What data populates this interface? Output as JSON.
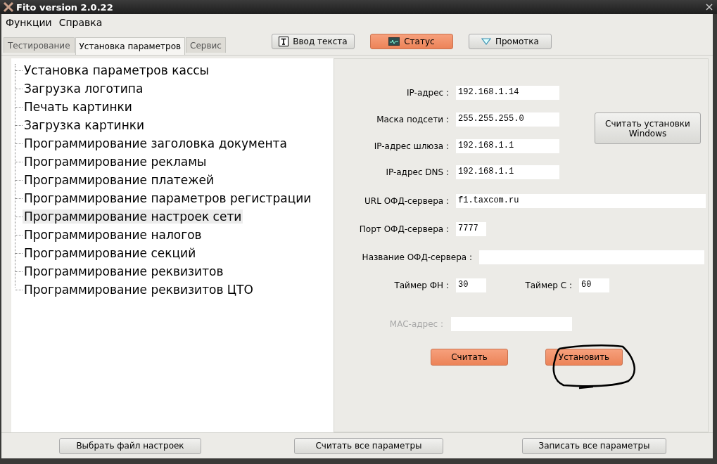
{
  "window": {
    "title": "Fito version 2.0.22"
  },
  "menu": [
    "Функции",
    "Справка"
  ],
  "tabs": [
    {
      "label": "Тестирование",
      "selected": false
    },
    {
      "label": "Установка параметров",
      "selected": true
    },
    {
      "label": "Сервис",
      "selected": false
    }
  ],
  "toolbar": [
    {
      "label": "Ввод текста",
      "kind": "text",
      "selected": false
    },
    {
      "label": "Статус",
      "kind": "monitor",
      "selected": true
    },
    {
      "label": "Промотка",
      "kind": "triangle",
      "selected": false
    }
  ],
  "tree": [
    {
      "label": "Установка параметров кассы",
      "selected": false
    },
    {
      "label": "Загрузка логотипа",
      "selected": false
    },
    {
      "label": "Печать картинки",
      "selected": false
    },
    {
      "label": "Загрузка картинки",
      "selected": false
    },
    {
      "label": "Программирование заголовка документа",
      "selected": false
    },
    {
      "label": "Программирование рекламы",
      "selected": false
    },
    {
      "label": "Программирование платежей",
      "selected": false
    },
    {
      "label": "Программирование параметров регистрации",
      "selected": false
    },
    {
      "label": "Программирование настроек сети",
      "selected": true
    },
    {
      "label": "Программирование налогов",
      "selected": false
    },
    {
      "label": "Программирование секций",
      "selected": false
    },
    {
      "label": "Программирование реквизитов",
      "selected": false
    },
    {
      "label": "Программирование реквизитов ЦТО",
      "selected": false
    }
  ],
  "network_form": {
    "address_fields": [
      {
        "label": "IP-адрес :",
        "value": "192.168.1.14"
      },
      {
        "label": "Маска подсети :",
        "value": "255.255.255.0"
      },
      {
        "label": "IP-адрес шлюза :",
        "value": "192.168.1.1"
      },
      {
        "label": "IP-адрес DNS :",
        "value": "192.168.1.1"
      }
    ],
    "read_windows_button": "Считать установки Windows",
    "server_fields": [
      {
        "label": "URL ОФД-сервера :",
        "value": "f1.taxcom.ru"
      },
      {
        "label": "Порт ОФД-сервера :",
        "value": "7777"
      },
      {
        "label": "Название ОФД-сервера :"
      }
    ],
    "timers": [
      {
        "label": "Таймер ФН :",
        "value": "30"
      },
      {
        "label": "Таймер С :",
        "value": "60"
      }
    ],
    "mac": {
      "label": "MAC-адрес :",
      "disabled": true
    },
    "buttons": [
      "Считать",
      "Установить"
    ]
  },
  "bottom_buttons": [
    "Выбрать файл настроек",
    "Считать все параметры",
    "Записать все параметры"
  ]
}
